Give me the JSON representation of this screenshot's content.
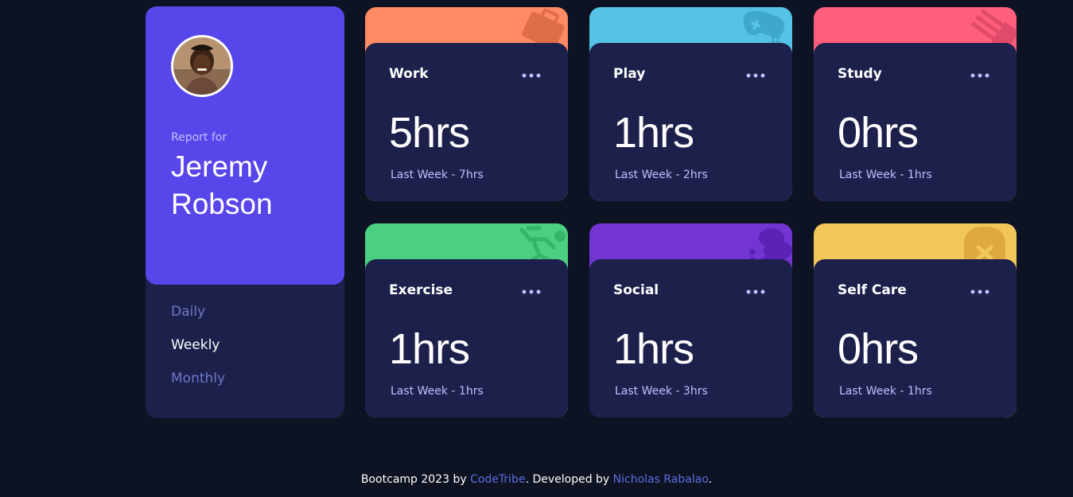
{
  "profile": {
    "report_for": "Report for",
    "name": "Jeremy Robson",
    "periods": [
      "Daily",
      "Weekly",
      "Monthly"
    ],
    "active_period": "Weekly"
  },
  "cards": [
    {
      "title": "Work",
      "current": "5hrs",
      "previous": "Last Week - 7hrs",
      "color": "#ff8b64",
      "icon": "briefcase-icon"
    },
    {
      "title": "Play",
      "current": "1hrs",
      "previous": "Last Week - 2hrs",
      "color": "#55c2e6",
      "icon": "gamepad-icon"
    },
    {
      "title": "Study",
      "current": "0hrs",
      "previous": "Last Week - 1hrs",
      "color": "#ff5e7d",
      "icon": "books-icon"
    },
    {
      "title": "Exercise",
      "current": "1hrs",
      "previous": "Last Week - 1hrs",
      "color": "#4bcf82",
      "icon": "running-icon"
    },
    {
      "title": "Social",
      "current": "1hrs",
      "previous": "Last Week - 3hrs",
      "color": "#7335d2",
      "icon": "social-icon"
    },
    {
      "title": "Self Care",
      "current": "0hrs",
      "previous": "Last Week - 1hrs",
      "color": "#f1c75b",
      "icon": "self-care-icon"
    }
  ],
  "footer": {
    "prefix": "Bootcamp 2023 by ",
    "org": "CodeTribe",
    "middle": ". Developed by ",
    "author": "Nicholas Rabalao",
    "suffix": "."
  }
}
